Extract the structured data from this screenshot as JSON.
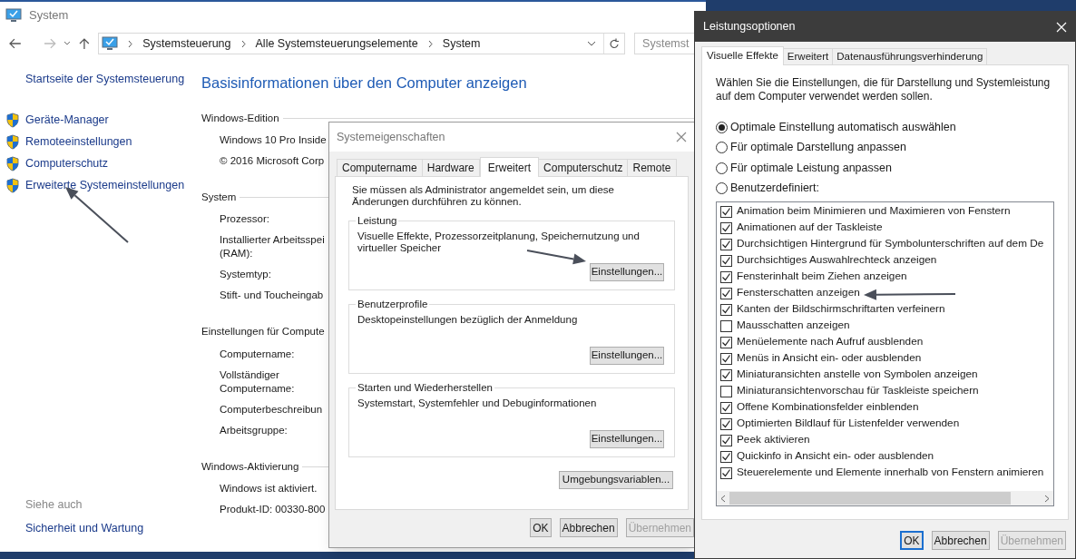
{
  "system_window": {
    "title": "System",
    "breadcrumb": [
      "Systemsteuerung",
      "Alle Systemsteuerungselemente",
      "System"
    ],
    "search": {
      "placeholder": "Systemst"
    },
    "sidebar": {
      "items": [
        {
          "label": "Startseite der Systemsteuerung",
          "kind": "home"
        },
        {
          "label": "Geräte-Manager",
          "kind": "shield"
        },
        {
          "label": "Remoteeinstellungen",
          "kind": "shield"
        },
        {
          "label": "Computerschutz",
          "kind": "shield"
        },
        {
          "label": "Erweiterte Systemeinstellungen",
          "kind": "shield"
        }
      ],
      "see_also_heading": "Siehe auch",
      "see_also_items": [
        "Sicherheit und Wartung"
      ]
    },
    "heading": "Basisinformationen über den Computer anzeigen",
    "sections": [
      {
        "title": "Windows-Edition",
        "rows": [
          "Windows 10 Pro Inside",
          "© 2016 Microsoft Corp"
        ]
      },
      {
        "title": "System",
        "rows": [
          "Prozessor:",
          "Installierter Arbeitsspei\n(RAM):",
          "Systemtyp:",
          "Stift- und Toucheingab"
        ]
      },
      {
        "title": "Einstellungen für Compute",
        "rows": [
          "Computername:",
          "Vollständiger\nComputername:",
          "Computerbeschreibun",
          "Arbeitsgruppe:"
        ]
      },
      {
        "title": "Windows-Aktivierung",
        "rows": [
          "Windows ist aktiviert.",
          "Produkt-ID:  00330-800"
        ]
      }
    ]
  },
  "system_properties": {
    "title": "Systemeigenschaften",
    "tabs": [
      {
        "label": "Computername",
        "selected": false
      },
      {
        "label": "Hardware",
        "selected": false
      },
      {
        "label": "Erweitert",
        "selected": true
      },
      {
        "label": "Computerschutz",
        "selected": false
      },
      {
        "label": "Remote",
        "selected": false
      }
    ],
    "intro": "Sie müssen als Administrator angemeldet sein, um diese Änderungen durchführen zu können.",
    "groups": [
      {
        "title": "Leistung",
        "text": "Visuelle Effekte, Prozessorzeitplanung, Speichernutzung und virtueller Speicher",
        "button": "Einstellungen..."
      },
      {
        "title": "Benutzerprofile",
        "text": "Desktopeinstellungen bezüglich der Anmeldung",
        "button": "Einstellungen..."
      },
      {
        "title": "Starten und Wiederherstellen",
        "text": "Systemstart, Systemfehler und Debuginformationen",
        "button": "Einstellungen..."
      }
    ],
    "env_button": "Umgebungsvariablen...",
    "buttons": [
      {
        "label": "OK",
        "default": false,
        "disabled": false
      },
      {
        "label": "Abbrechen",
        "default": false,
        "disabled": false
      },
      {
        "label": "Übernehmen",
        "default": false,
        "disabled": true
      }
    ]
  },
  "performance_options": {
    "title": "Leistungsoptionen",
    "tabs": [
      {
        "label": "Visuelle Effekte",
        "selected": true
      },
      {
        "label": "Erweitert",
        "selected": false
      },
      {
        "label": "Datenausführungsverhinderung",
        "selected": false
      }
    ],
    "intro": "Wählen Sie die Einstellungen, die für Darstellung und Systemleistung auf dem Computer verwendet werden sollen.",
    "radios": [
      {
        "label": "Optimale Einstellung automatisch auswählen",
        "selected": true
      },
      {
        "label": "Für optimale Darstellung anpassen",
        "selected": false
      },
      {
        "label": "Für optimale Leistung anpassen",
        "selected": false
      },
      {
        "label": "Benutzerdefiniert:",
        "selected": false
      }
    ],
    "effects": [
      {
        "label": "Animation beim Minimieren und Maximieren von Fenstern",
        "checked": true
      },
      {
        "label": "Animationen auf der Taskleiste",
        "checked": true
      },
      {
        "label": "Durchsichtigen Hintergrund für Symbolunterschriften auf dem De",
        "checked": true
      },
      {
        "label": "Durchsichtiges Auswahlrechteck anzeigen",
        "checked": true
      },
      {
        "label": "Fensterinhalt beim Ziehen anzeigen",
        "checked": true
      },
      {
        "label": "Fensterschatten anzeigen",
        "checked": true
      },
      {
        "label": "Kanten der Bildschirmschriftarten verfeinern",
        "checked": true
      },
      {
        "label": "Mausschatten anzeigen",
        "checked": false
      },
      {
        "label": "Menüelemente nach Aufruf ausblenden",
        "checked": true
      },
      {
        "label": "Menüs in Ansicht ein- oder ausblenden",
        "checked": true
      },
      {
        "label": "Miniaturansichten anstelle von Symbolen anzeigen",
        "checked": true
      },
      {
        "label": "Miniaturansichtenvorschau für Taskleiste speichern",
        "checked": false
      },
      {
        "label": "Offene Kombinationsfelder einblenden",
        "checked": true
      },
      {
        "label": "Optimierten Bildlauf für Listenfelder verwenden",
        "checked": true
      },
      {
        "label": "Peek aktivieren",
        "checked": true
      },
      {
        "label": "Quickinfo in Ansicht ein- oder ausblenden",
        "checked": true
      },
      {
        "label": "Steuerelemente und Elemente innerhalb von Fenstern animieren",
        "checked": true
      }
    ],
    "buttons": [
      {
        "label": "OK",
        "default": true,
        "disabled": false
      },
      {
        "label": "Abbrechen",
        "default": false,
        "disabled": false
      },
      {
        "label": "Übernehmen",
        "default": false,
        "disabled": true
      }
    ]
  }
}
